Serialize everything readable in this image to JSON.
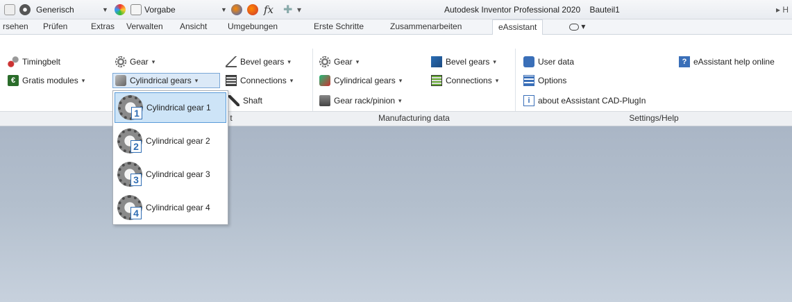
{
  "titlebar": {
    "style_value": "Generisch",
    "appearance_value": "Vorgabe",
    "fx_label": "fx",
    "app_name": "Autodesk Inventor Professional 2020",
    "document": "Bauteil1",
    "overflow": "▸ H"
  },
  "tabs": [
    {
      "label": "rsehen"
    },
    {
      "label": "Prüfen"
    },
    {
      "label": "Extras"
    },
    {
      "label": "Verwalten"
    },
    {
      "label": "Ansicht"
    },
    {
      "label": "Umgebungen"
    },
    {
      "label": "Erste Schritte"
    },
    {
      "label": "Zusammenarbeiten"
    },
    {
      "label": "eAssistant"
    },
    {
      "label": "▾"
    }
  ],
  "ribbon": {
    "timingbelt": "Timingbelt",
    "gratis_modules": "Gratis modules",
    "gear": "Gear",
    "cylindrical_gears": "Cylindrical gears",
    "shaft": "Shaft",
    "bevel_gears": "Bevel gears",
    "connections": "Connections",
    "mfg_gear": "Gear",
    "mfg_cylindrical_gears": "Cylindrical gears",
    "mfg_gear_rack": "Gear rack/pinion",
    "mfg_bevel_gears": "Bevel gears",
    "mfg_connections": "Connections",
    "user_data": "User data",
    "options": "Options",
    "about": "about eAssistant CAD-PlugIn",
    "help_online": "eAssistant help online",
    "panel_design_suffix": "t",
    "panel_manufacturing": "Manufacturing data",
    "panel_settings": "Settings/Help",
    "dropdown_arrow": "▾"
  },
  "menu": {
    "items": [
      {
        "label": "Cylindrical gear 1",
        "num": "1",
        "highlighted": true
      },
      {
        "label": "Cylindrical gear 2",
        "num": "2"
      },
      {
        "label": "Cylindrical gear 3",
        "num": "3"
      },
      {
        "label": "Cylindrical gear 4",
        "num": "4"
      }
    ]
  },
  "colors": {
    "highlight_bg": "#cde4f7",
    "highlight_border": "#5a9bd8",
    "viewport_top": "#aab6c6",
    "viewport_bottom": "#c7d1dd"
  }
}
